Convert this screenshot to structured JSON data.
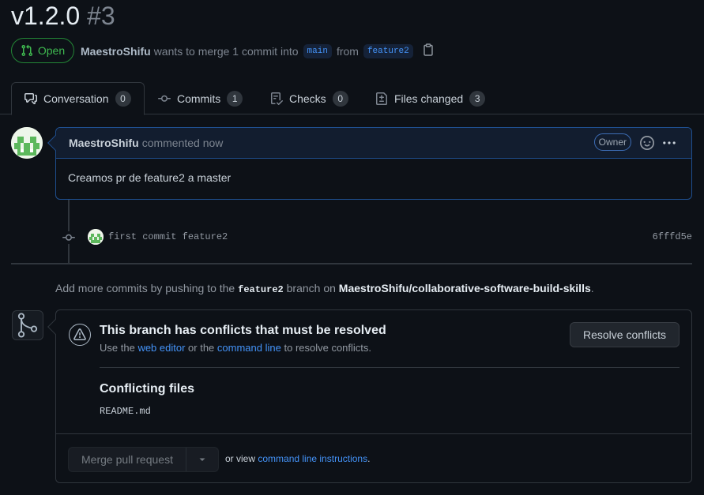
{
  "pr": {
    "title": "v1.2.0",
    "number": "#3",
    "state": "Open",
    "author": "MaestroShifu",
    "merge_text": "wants to merge 1 commit into",
    "base_branch": "main",
    "from_text": "from",
    "head_branch": "feature2"
  },
  "tabs": [
    {
      "label": "Conversation",
      "count": "0",
      "icon": "comment-discussion-icon"
    },
    {
      "label": "Commits",
      "count": "1",
      "icon": "git-commit-icon"
    },
    {
      "label": "Checks",
      "count": "0",
      "icon": "checklist-icon"
    },
    {
      "label": "Files changed",
      "count": "3",
      "icon": "file-diff-icon"
    }
  ],
  "comment": {
    "author": "MaestroShifu",
    "time": "commented now",
    "role": "Owner",
    "body": "Creamos pr de feature2 a master"
  },
  "commit": {
    "message": "first commit feature2",
    "sha": "6fffd5e"
  },
  "push_hint": {
    "prefix": "Add more commits by pushing to the",
    "branch": "feature2",
    "middle": "branch on",
    "repo": "MaestroShifu/collaborative-software-build-skills",
    "suffix": "."
  },
  "merge": {
    "conflict_title": "This branch has conflicts that must be resolved",
    "sub_prefix": "Use the",
    "web_editor": "web editor",
    "sub_or": "or the",
    "command_line": "command line",
    "sub_suffix": "to resolve conflicts.",
    "resolve_button": "Resolve conflicts",
    "conflicting_title": "Conflicting files",
    "files": [
      "README.md"
    ],
    "merge_button": "Merge pull request",
    "or_view": "or view",
    "cli_instructions": "command line instructions",
    "period": "."
  },
  "colors": {
    "accent_green": "#3fb950",
    "link_blue": "#4493f8",
    "comment_border": "#1f4f8f"
  }
}
